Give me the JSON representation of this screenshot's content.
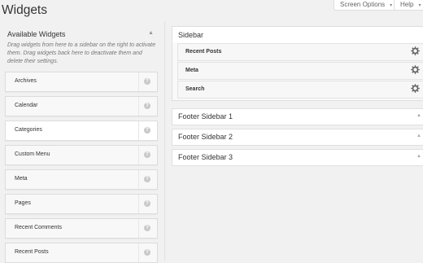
{
  "page": {
    "title": "Widgets"
  },
  "top_buttons": {
    "screen_options": "Screen Options",
    "help": "Help",
    "arrow": "▾"
  },
  "available": {
    "title": "Available Widgets",
    "toggle": "▲",
    "description": "Drag widgets from here to a sidebar on the right to activate them. Drag widgets back here to deactivate them and delete their settings.",
    "items": [
      {
        "label": "Archives"
      },
      {
        "label": "Calendar"
      },
      {
        "label": "Categories"
      },
      {
        "label": "Custom Menu"
      },
      {
        "label": "Meta"
      },
      {
        "label": "Pages"
      },
      {
        "label": "Recent Comments"
      },
      {
        "label": "Recent Posts"
      }
    ],
    "help_glyph": "?"
  },
  "sidebar": {
    "title": "Sidebar",
    "widgets": [
      {
        "label": "Recent Posts"
      },
      {
        "label": "Meta"
      },
      {
        "label": "Search"
      }
    ]
  },
  "footer_sidebars": [
    {
      "label": "Footer Sidebar 1"
    },
    {
      "label": "Footer Sidebar 2"
    },
    {
      "label": "Footer Sidebar 3"
    }
  ],
  "footer_arrow": "▲"
}
